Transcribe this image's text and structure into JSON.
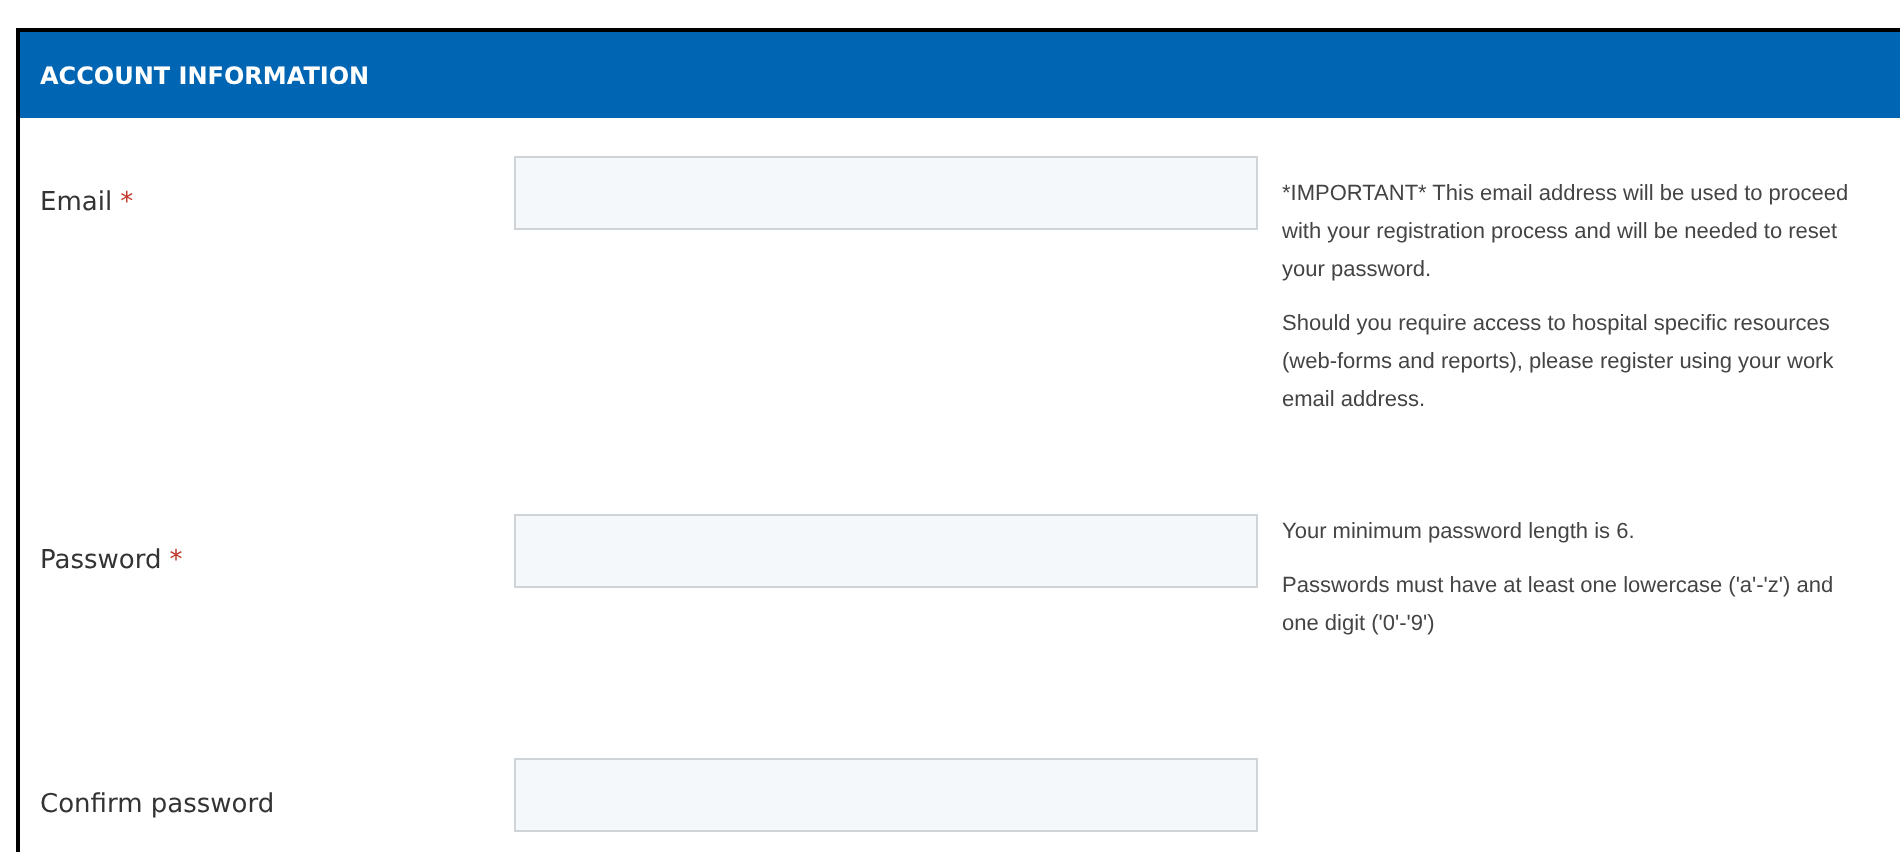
{
  "section": {
    "title": "ACCOUNT INFORMATION"
  },
  "required_marker": "*",
  "fields": [
    {
      "label": "Email",
      "required": true,
      "notes": [
        "*IMPORTANT* This email address will be used to proceed with your registration process and will be needed to reset your password.",
        "Should you require access to hospital specific resources (web-forms and reports), please register using your work email address."
      ]
    },
    {
      "label": "Password",
      "required": true,
      "notes": [
        "Your minimum password length is 6.",
        "Passwords must have at least one lowercase ('a'-'z') and one digit ('0'-'9')"
      ]
    },
    {
      "label": "Confirm password",
      "required": false
    }
  ]
}
